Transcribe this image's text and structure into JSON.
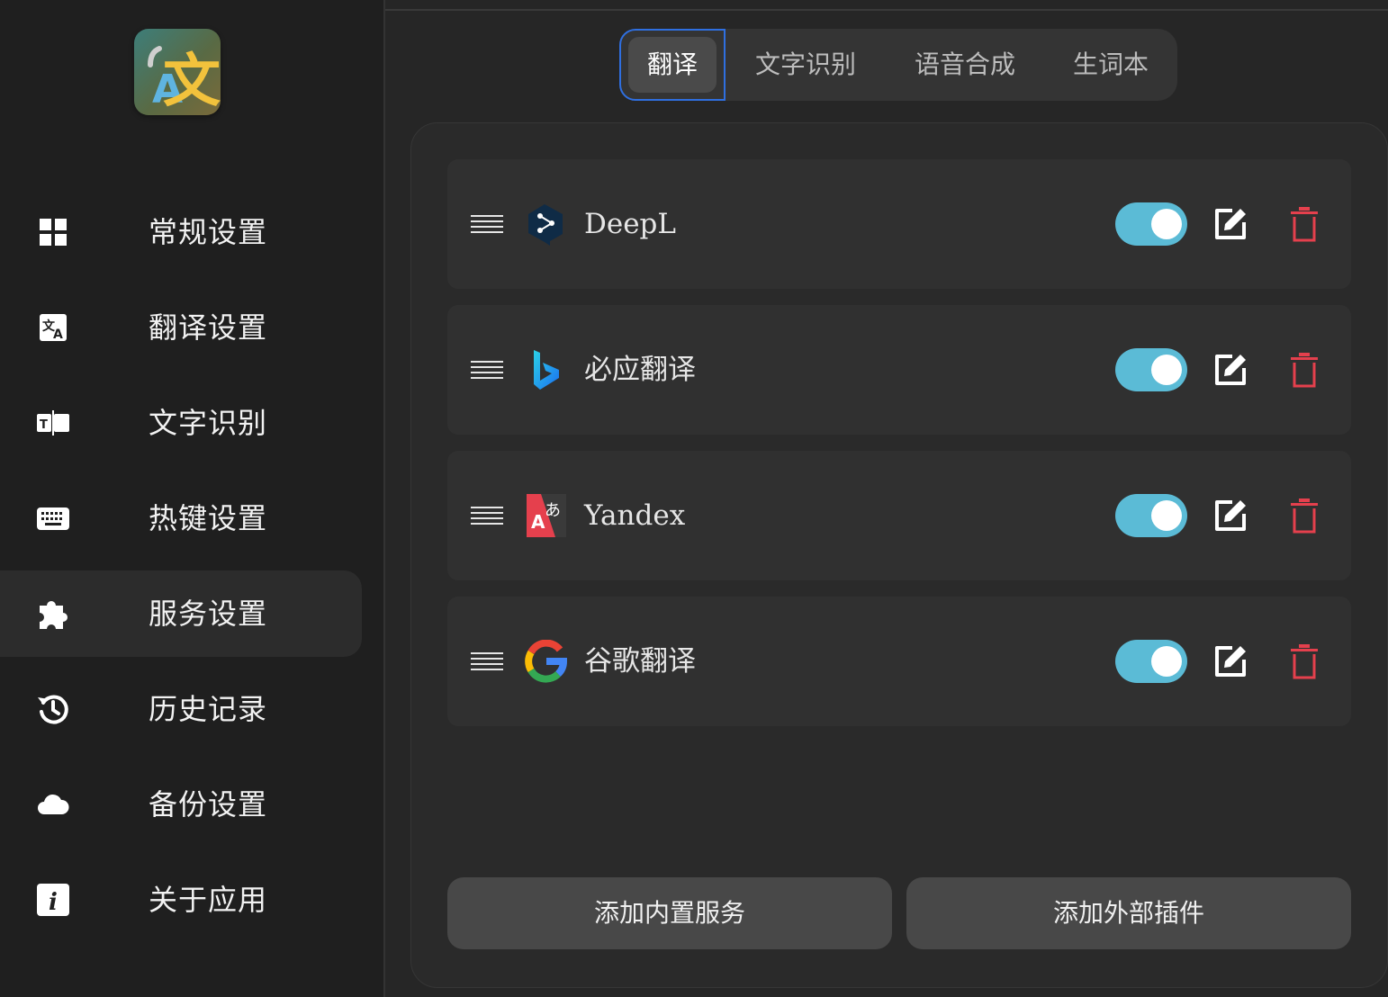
{
  "sidebar": {
    "items": [
      {
        "label": "常规设置",
        "icon": "grid-icon"
      },
      {
        "label": "翻译设置",
        "icon": "translate-icon"
      },
      {
        "label": "文字识别",
        "icon": "text-recognition-icon"
      },
      {
        "label": "热键设置",
        "icon": "keyboard-icon"
      },
      {
        "label": "服务设置",
        "icon": "puzzle-icon",
        "active": true
      },
      {
        "label": "历史记录",
        "icon": "history-icon"
      },
      {
        "label": "备份设置",
        "icon": "cloud-icon"
      },
      {
        "label": "关于应用",
        "icon": "info-icon"
      }
    ]
  },
  "tabs": [
    {
      "label": "翻译",
      "active": true
    },
    {
      "label": "文字识别"
    },
    {
      "label": "语音合成"
    },
    {
      "label": "生词本"
    }
  ],
  "services": [
    {
      "name": "DeepL",
      "logo": "deepl-logo-icon",
      "enabled": true
    },
    {
      "name": "必应翻译",
      "logo": "bing-logo-icon",
      "enabled": true
    },
    {
      "name": "Yandex",
      "logo": "yandex-logo-icon",
      "enabled": true
    },
    {
      "name": "谷歌翻译",
      "logo": "google-logo-icon",
      "enabled": true
    }
  ],
  "buttons": {
    "add_builtin": "添加内置服务",
    "add_external": "添加外部插件"
  },
  "colors": {
    "accent_toggle": "#5bbbd6",
    "delete_red": "#e5404d",
    "tab_focus": "#2f6fe0"
  }
}
